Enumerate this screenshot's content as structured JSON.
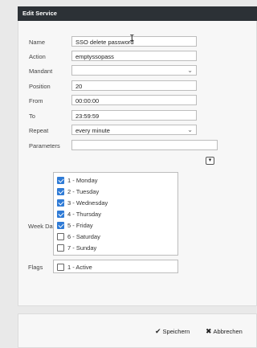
{
  "dialog": {
    "title": "Edit Service"
  },
  "form": {
    "name": {
      "label": "Name",
      "value": "SSO delete password"
    },
    "action": {
      "label": "Action",
      "value": "emptyssopass"
    },
    "mandant": {
      "label": "Mandant",
      "value": ""
    },
    "position": {
      "label": "Position",
      "value": "20"
    },
    "from": {
      "label": "From",
      "value": "00:00:00"
    },
    "to": {
      "label": "To",
      "value": "23:59:59"
    },
    "repeat": {
      "label": "Repeat",
      "value": "every minute"
    },
    "parameters": {
      "label": "Parameters",
      "value": "",
      "button_icon": "expand-icon"
    },
    "week_days": {
      "label": "Week Days",
      "items": [
        {
          "label": "1 - Monday",
          "checked": true
        },
        {
          "label": "2 - Tuesday",
          "checked": true
        },
        {
          "label": "3 - Wednesday",
          "checked": true
        },
        {
          "label": "4 - Thursday",
          "checked": true
        },
        {
          "label": "5 - Friday",
          "checked": true
        },
        {
          "label": "6 - Saturday",
          "checked": false
        },
        {
          "label": "7 - Sunday",
          "checked": false
        }
      ]
    },
    "flags": {
      "label": "Flags",
      "items": [
        {
          "label": "1 - Active",
          "checked": false
        }
      ]
    }
  },
  "footer": {
    "save_label": "Speichern",
    "cancel_label": "Abbrechen"
  },
  "colors": {
    "titlebar": "#2c3136",
    "checkbox_checked": "#2f7bd6"
  }
}
